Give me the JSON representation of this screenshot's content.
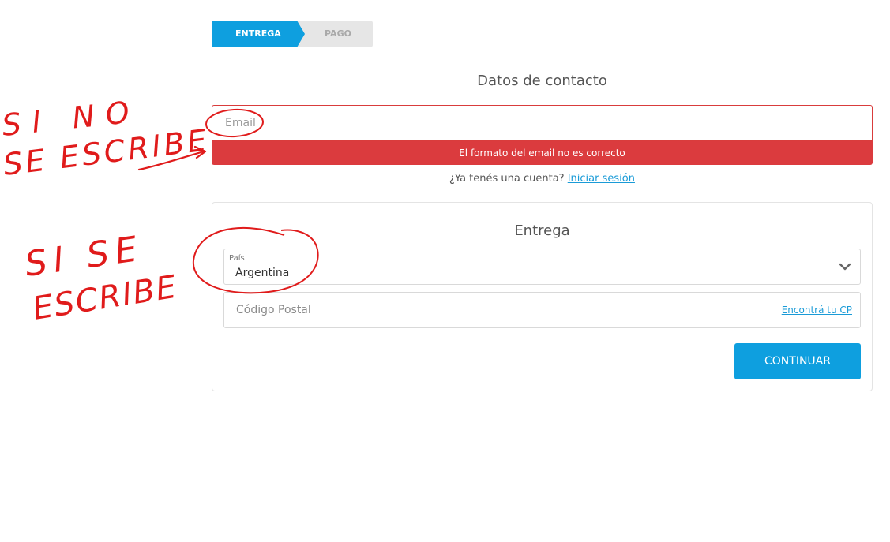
{
  "steps": {
    "active": "ENTREGA",
    "next": "PAGO",
    "active_color": "#0e9fdf"
  },
  "contact": {
    "title": "Datos de contacto",
    "email_placeholder": "Email",
    "email_value": "",
    "error_message": "El formato del email no es correcto",
    "error_color": "#db3b3e",
    "login_prompt": "¿Ya tenés una cuenta?",
    "login_link": "Iniciar sesión"
  },
  "delivery": {
    "title": "Entrega",
    "country_label": "País",
    "country_value": "Argentina",
    "postal_placeholder": "Código Postal",
    "find_cp_link": "Encontrá tu CP",
    "continue_button": "CONTINUAR",
    "chevron_icon": "chevron-down-icon"
  },
  "annotations": {
    "note_1_line_1": "SI NO",
    "note_1_line_2": "SE ESCRIBE",
    "note_2_line_1": "SI SE",
    "note_2_line_2": "ESCRIBE",
    "ink_color": "#e01b1b"
  }
}
